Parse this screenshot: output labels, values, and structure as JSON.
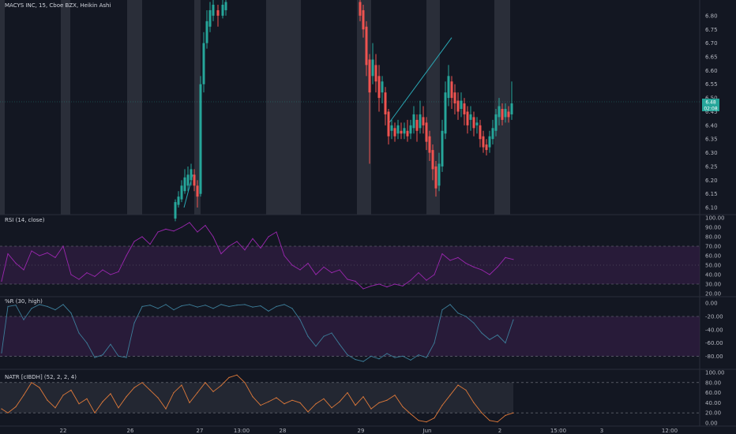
{
  "header": {
    "symbol": "MACYS INC, 15, Cboe BZX, Heikin Ashi"
  },
  "colors": {
    "background": "#131722",
    "session_band": "#2a2e39",
    "up": "#26a69a",
    "down": "#ef5350",
    "rsi_line": "#9c27b0",
    "wr_line": "#3d7e9a",
    "natr_line": "#e07a3a",
    "band_fill": "#3a1f4d",
    "trendline": "#2aa7b4",
    "grid": "#1e222d"
  },
  "price_tags": {
    "last": "6.48",
    "countdown": "02:08"
  },
  "chart_data": [
    {
      "type": "candlestick",
      "title": "MACYS INC, 15, Cboe BZX, Heikin Ashi",
      "ylim": [
        6.08,
        6.84
      ],
      "y_ticks": [
        "6.80",
        "6.75",
        "6.70",
        "6.65",
        "6.60",
        "6.55",
        "6.50",
        "6.45",
        "6.40",
        "6.35",
        "6.30",
        "6.25",
        "6.20",
        "6.15",
        "6.10"
      ],
      "x_tick_labels": [
        "22",
        "26",
        "27",
        "13:00",
        "28",
        "29",
        "Jun",
        "2",
        "15:00",
        "3",
        "12:00"
      ],
      "session_bands": [
        [
          0,
          6
        ],
        [
          77,
          89
        ],
        [
          161,
          180
        ],
        [
          246,
          254
        ],
        [
          337,
          381
        ],
        [
          452,
          470
        ],
        [
          540,
          557
        ],
        [
          626,
          646
        ]
      ],
      "candles": [
        {
          "t": 222,
          "o": 6.06,
          "c": 6.12,
          "h": 6.13,
          "l": 6.05
        },
        {
          "t": 226,
          "o": 6.11,
          "c": 6.14,
          "h": 6.16,
          "l": 6.1
        },
        {
          "t": 230,
          "o": 6.13,
          "c": 6.18,
          "h": 6.2,
          "l": 6.12
        },
        {
          "t": 234,
          "o": 6.16,
          "c": 6.21,
          "h": 6.24,
          "l": 6.15
        },
        {
          "t": 238,
          "o": 6.18,
          "c": 6.22,
          "h": 6.25,
          "l": 6.16
        },
        {
          "t": 242,
          "o": 6.2,
          "c": 6.24,
          "h": 6.26,
          "l": 6.18
        },
        {
          "t": 246,
          "o": 6.22,
          "c": 6.18,
          "h": 6.24,
          "l": 6.16
        },
        {
          "t": 250,
          "o": 6.18,
          "c": 6.14,
          "h": 6.2,
          "l": 6.1
        },
        {
          "t": 254,
          "o": 6.15,
          "c": 6.55,
          "h": 6.58,
          "l": 6.14
        },
        {
          "t": 258,
          "o": 6.55,
          "c": 6.7,
          "h": 6.74,
          "l": 6.52
        },
        {
          "t": 262,
          "o": 6.7,
          "c": 6.78,
          "h": 6.82,
          "l": 6.68
        },
        {
          "t": 266,
          "o": 6.76,
          "c": 6.82,
          "h": 6.85,
          "l": 6.74
        },
        {
          "t": 270,
          "o": 6.8,
          "c": 6.84,
          "h": 6.86,
          "l": 6.78
        },
        {
          "t": 276,
          "o": 6.82,
          "c": 6.8,
          "h": 6.84,
          "l": 6.76
        },
        {
          "t": 282,
          "o": 6.8,
          "c": 6.84,
          "h": 6.86,
          "l": 6.79
        },
        {
          "t": 286,
          "o": 6.82,
          "c": 6.85,
          "h": 6.86,
          "l": 6.8
        },
        {
          "t": 456,
          "o": 6.85,
          "c": 6.8,
          "h": 6.86,
          "l": 6.78
        },
        {
          "t": 460,
          "o": 6.82,
          "c": 6.75,
          "h": 6.84,
          "l": 6.72
        },
        {
          "t": 464,
          "o": 6.76,
          "c": 6.62,
          "h": 6.78,
          "l": 6.58
        },
        {
          "t": 468,
          "o": 6.64,
          "c": 6.52,
          "h": 6.66,
          "l": 6.26
        },
        {
          "t": 472,
          "o": 6.58,
          "c": 6.64,
          "h": 6.7,
          "l": 6.55
        },
        {
          "t": 476,
          "o": 6.62,
          "c": 6.56,
          "h": 6.66,
          "l": 6.52
        },
        {
          "t": 480,
          "o": 6.58,
          "c": 6.5,
          "h": 6.62,
          "l": 6.45
        },
        {
          "t": 484,
          "o": 6.52,
          "c": 6.56,
          "h": 6.58,
          "l": 6.48
        },
        {
          "t": 488,
          "o": 6.52,
          "c": 6.44,
          "h": 6.54,
          "l": 6.4
        },
        {
          "t": 492,
          "o": 6.45,
          "c": 6.36,
          "h": 6.46,
          "l": 6.33
        },
        {
          "t": 496,
          "o": 6.38,
          "c": 6.4,
          "h": 6.42,
          "l": 6.35
        },
        {
          "t": 500,
          "o": 6.39,
          "c": 6.36,
          "h": 6.41,
          "l": 6.34
        },
        {
          "t": 504,
          "o": 6.37,
          "c": 6.4,
          "h": 6.42,
          "l": 6.35
        },
        {
          "t": 508,
          "o": 6.38,
          "c": 6.37,
          "h": 6.41,
          "l": 6.35
        },
        {
          "t": 512,
          "o": 6.37,
          "c": 6.39,
          "h": 6.41,
          "l": 6.35
        },
        {
          "t": 516,
          "o": 6.38,
          "c": 6.36,
          "h": 6.42,
          "l": 6.34
        },
        {
          "t": 520,
          "o": 6.37,
          "c": 6.4,
          "h": 6.42,
          "l": 6.35
        },
        {
          "t": 524,
          "o": 6.39,
          "c": 6.44,
          "h": 6.47,
          "l": 6.37
        },
        {
          "t": 528,
          "o": 6.42,
          "c": 6.38,
          "h": 6.44,
          "l": 6.34
        },
        {
          "t": 532,
          "o": 6.39,
          "c": 6.44,
          "h": 6.49,
          "l": 6.37
        },
        {
          "t": 536,
          "o": 6.43,
          "c": 6.4,
          "h": 6.47,
          "l": 6.37
        },
        {
          "t": 540,
          "o": 6.41,
          "c": 6.34,
          "h": 6.43,
          "l": 6.31
        },
        {
          "t": 544,
          "o": 6.36,
          "c": 6.3,
          "h": 6.38,
          "l": 6.27
        },
        {
          "t": 548,
          "o": 6.31,
          "c": 6.24,
          "h": 6.33,
          "l": 6.2
        },
        {
          "t": 552,
          "o": 6.25,
          "c": 6.17,
          "h": 6.27,
          "l": 6.14
        },
        {
          "t": 556,
          "o": 6.18,
          "c": 6.26,
          "h": 6.3,
          "l": 6.16
        },
        {
          "t": 560,
          "o": 6.25,
          "c": 6.38,
          "h": 6.42,
          "l": 6.23
        },
        {
          "t": 564,
          "o": 6.37,
          "c": 6.52,
          "h": 6.56,
          "l": 6.35
        },
        {
          "t": 568,
          "o": 6.5,
          "c": 6.58,
          "h": 6.62,
          "l": 6.47
        },
        {
          "t": 572,
          "o": 6.56,
          "c": 6.5,
          "h": 6.58,
          "l": 6.46
        },
        {
          "t": 576,
          "o": 6.52,
          "c": 6.48,
          "h": 6.55,
          "l": 6.44
        },
        {
          "t": 580,
          "o": 6.49,
          "c": 6.45,
          "h": 6.52,
          "l": 6.42
        },
        {
          "t": 584,
          "o": 6.46,
          "c": 6.49,
          "h": 6.52,
          "l": 6.43
        },
        {
          "t": 588,
          "o": 6.48,
          "c": 6.44,
          "h": 6.5,
          "l": 6.4
        },
        {
          "t": 592,
          "o": 6.45,
          "c": 6.4,
          "h": 6.47,
          "l": 6.37
        },
        {
          "t": 596,
          "o": 6.42,
          "c": 6.44,
          "h": 6.47,
          "l": 6.38
        },
        {
          "t": 600,
          "o": 6.43,
          "c": 6.39,
          "h": 6.45,
          "l": 6.36
        },
        {
          "t": 604,
          "o": 6.4,
          "c": 6.41,
          "h": 6.43,
          "l": 6.37
        },
        {
          "t": 608,
          "o": 6.4,
          "c": 6.35,
          "h": 6.42,
          "l": 6.32
        },
        {
          "t": 612,
          "o": 6.36,
          "c": 6.32,
          "h": 6.38,
          "l": 6.3
        },
        {
          "t": 616,
          "o": 6.33,
          "c": 6.31,
          "h": 6.35,
          "l": 6.29
        },
        {
          "t": 620,
          "o": 6.32,
          "c": 6.36,
          "h": 6.38,
          "l": 6.3
        },
        {
          "t": 624,
          "o": 6.35,
          "c": 6.39,
          "h": 6.42,
          "l": 6.33
        },
        {
          "t": 628,
          "o": 6.38,
          "c": 6.44,
          "h": 6.46,
          "l": 6.36
        },
        {
          "t": 632,
          "o": 6.43,
          "c": 6.47,
          "h": 6.5,
          "l": 6.4
        },
        {
          "t": 636,
          "o": 6.46,
          "c": 6.42,
          "h": 6.48,
          "l": 6.4
        },
        {
          "t": 640,
          "o": 6.43,
          "c": 6.46,
          "h": 6.48,
          "l": 6.41
        },
        {
          "t": 644,
          "o": 6.45,
          "c": 6.43,
          "h": 6.47,
          "l": 6.41
        },
        {
          "t": 648,
          "o": 6.44,
          "c": 6.48,
          "h": 6.56,
          "l": 6.42
        }
      ],
      "trendlines": [
        {
          "p1": [
            233,
            6.1
          ],
          "p2": [
            244,
            6.22
          ]
        },
        {
          "p1": [
            493,
            6.41
          ],
          "p2": [
            572,
            6.72
          ]
        }
      ]
    },
    {
      "type": "line",
      "title": "RSI (14, close)",
      "ylim": [
        20,
        100
      ],
      "y_ticks": [
        "100.00",
        "90.00",
        "80.00",
        "70.00",
        "60.00",
        "50.00",
        "40.00",
        "30.00",
        "20.00"
      ],
      "band": [
        30,
        70
      ],
      "midline": 50,
      "x": [
        2,
        10,
        20,
        30,
        40,
        50,
        60,
        70,
        80,
        90,
        100,
        110,
        120,
        130,
        140,
        150,
        160,
        170,
        180,
        190,
        200,
        210,
        220,
        230,
        240,
        250,
        260,
        270,
        280,
        290,
        300,
        310,
        320,
        330,
        340,
        350,
        360,
        370,
        380,
        390,
        400,
        410,
        420,
        430,
        440,
        450,
        460,
        470,
        480,
        490,
        500,
        510,
        520,
        530,
        540,
        550,
        560,
        570,
        580,
        590,
        600,
        610,
        620,
        630,
        640,
        650
      ],
      "values": [
        33,
        62,
        52,
        45,
        65,
        60,
        63,
        58,
        70,
        40,
        35,
        42,
        38,
        45,
        40,
        43,
        60,
        75,
        80,
        72,
        85,
        88,
        86,
        90,
        95,
        85,
        92,
        80,
        62,
        70,
        75,
        66,
        78,
        68,
        80,
        85,
        60,
        50,
        45,
        52,
        40,
        48,
        42,
        45,
        35,
        33,
        25,
        28,
        30,
        27,
        30,
        28,
        34,
        42,
        34,
        40,
        62,
        55,
        58,
        52,
        48,
        45,
        40,
        48,
        58,
        56
      ]
    },
    {
      "type": "line",
      "title": "%R (30, high)",
      "ylim": [
        -95,
        5
      ],
      "y_ticks": [
        "0.00",
        "-20.00",
        "-40.00",
        "-60.00",
        "-80.00"
      ],
      "band": [
        -80,
        -20
      ],
      "x": [
        2,
        10,
        20,
        30,
        40,
        50,
        60,
        70,
        80,
        90,
        100,
        110,
        120,
        130,
        140,
        150,
        160,
        170,
        180,
        190,
        200,
        210,
        220,
        230,
        240,
        250,
        260,
        270,
        280,
        290,
        300,
        310,
        320,
        330,
        340,
        350,
        360,
        370,
        380,
        390,
        400,
        410,
        420,
        430,
        440,
        450,
        460,
        470,
        480,
        490,
        500,
        510,
        520,
        530,
        540,
        550,
        560,
        570,
        580,
        590,
        600,
        610,
        620,
        630,
        640,
        650
      ],
      "values": [
        -75,
        -5,
        -3,
        -25,
        -8,
        -2,
        -5,
        -10,
        -2,
        -15,
        -45,
        -60,
        -82,
        -78,
        -62,
        -80,
        -82,
        -30,
        -5,
        -3,
        -8,
        -2,
        -10,
        -4,
        -2,
        -6,
        -3,
        -8,
        -2,
        -5,
        -3,
        -2,
        -6,
        -4,
        -12,
        -5,
        -2,
        -8,
        -25,
        -50,
        -65,
        -50,
        -45,
        -62,
        -78,
        -85,
        -88,
        -80,
        -84,
        -76,
        -82,
        -80,
        -86,
        -78,
        -82,
        -60,
        -10,
        -2,
        -15,
        -20,
        -30,
        -45,
        -55,
        -48,
        -60,
        -25
      ]
    },
    {
      "type": "area",
      "title": "NATR [cIBDH] (52, 2, 2, 4)",
      "ylim": [
        0,
        100
      ],
      "y_ticks": [
        "100.00",
        "80.00",
        "60.00",
        "40.00",
        "20.00",
        "0.00"
      ],
      "band": [
        20,
        80
      ],
      "x": [
        2,
        10,
        20,
        30,
        40,
        50,
        60,
        70,
        80,
        90,
        100,
        110,
        120,
        130,
        140,
        150,
        160,
        170,
        180,
        190,
        200,
        210,
        220,
        230,
        240,
        250,
        260,
        270,
        280,
        290,
        300,
        310,
        320,
        330,
        340,
        350,
        360,
        370,
        380,
        390,
        400,
        410,
        420,
        430,
        440,
        450,
        460,
        470,
        480,
        490,
        500,
        510,
        520,
        530,
        540,
        550,
        560,
        570,
        580,
        590,
        600,
        610,
        620,
        630,
        640,
        650
      ],
      "values": [
        28,
        20,
        32,
        55,
        80,
        70,
        45,
        30,
        55,
        65,
        38,
        48,
        20,
        42,
        58,
        30,
        52,
        70,
        80,
        65,
        50,
        28,
        60,
        75,
        40,
        60,
        80,
        62,
        74,
        90,
        95,
        80,
        52,
        35,
        42,
        50,
        38,
        45,
        40,
        22,
        38,
        48,
        30,
        42,
        60,
        35,
        52,
        28,
        40,
        45,
        55,
        32,
        18,
        5,
        2,
        10,
        35,
        55,
        75,
        65,
        40,
        20,
        5,
        2,
        15,
        20
      ]
    }
  ]
}
